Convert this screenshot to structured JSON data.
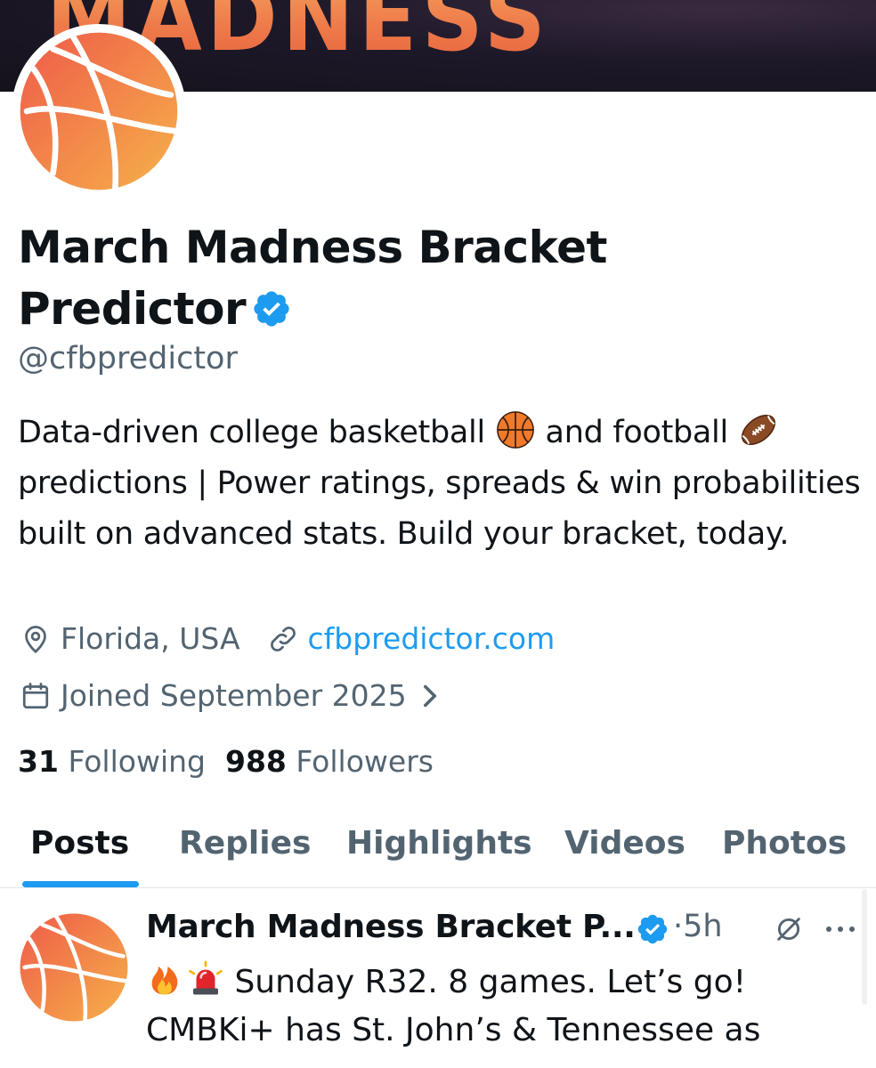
{
  "banner": {
    "text": "MADNESS"
  },
  "profile": {
    "display_name_line1": "March Madness Bracket",
    "display_name_line2": "Predictor",
    "handle": "@cfbpredictor",
    "bio": {
      "part1": "Data-driven college basketball ",
      "emoji1": "basketball-emoji",
      "part2": " and football ",
      "emoji2": "american-football-emoji",
      "part3": " predictions | Power ratings, spreads & win probabilities built on advanced stats. Build your bracket, today."
    },
    "location": "Florida, USA",
    "website": "cfbpredictor.com",
    "joined": "Joined September 2025",
    "following_count": "31",
    "following_label": "Following",
    "followers_count": "988",
    "followers_label": "Followers"
  },
  "tabs": [
    {
      "label": "Posts",
      "active": true
    },
    {
      "label": "Replies",
      "active": false
    },
    {
      "label": "Highlights",
      "active": false
    },
    {
      "label": "Videos",
      "active": false
    },
    {
      "label": "Photos",
      "active": false
    }
  ],
  "post": {
    "author": "March Madness Bracket P...",
    "time": "·5h",
    "line1_text": " Sunday R32. 8 games. Let’s go!",
    "line1_emojis": [
      "fire-emoji",
      "siren-emoji"
    ],
    "line2": "CMBKi+ has St. John’s & Tennessee as"
  },
  "colors": {
    "accent": "#1d9bf0",
    "text_primary": "#0f1419",
    "text_secondary": "#536471",
    "brand_orange": "#ef7a45"
  },
  "icons": [
    "location-pin-icon",
    "link-icon",
    "calendar-icon",
    "chevron-right-icon",
    "verified-badge-icon",
    "grok-icon",
    "more-icon"
  ]
}
